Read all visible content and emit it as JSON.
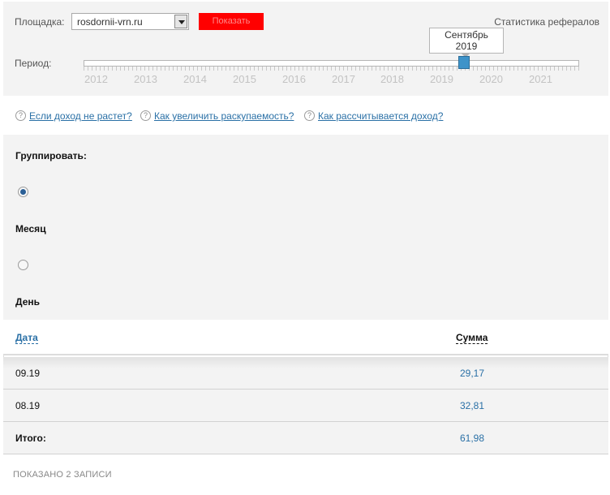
{
  "filters": {
    "site_label": "Площадка:",
    "site_value": "rosdornii-vrn.ru",
    "red_button_label": "Показать",
    "referral_stats_link": "Статистика рефералов"
  },
  "period": {
    "label": "Период:",
    "years": [
      "2012",
      "2013",
      "2014",
      "2015",
      "2016",
      "2017",
      "2018",
      "2019",
      "2020",
      "2021"
    ],
    "tooltip_month": "Сентябрь",
    "tooltip_year": "2019"
  },
  "help_links": [
    "Если доход не растет?",
    "Как увеличить раскупаемость?",
    "Как рассчитывается доход?"
  ],
  "help_icon_glyph": "?",
  "grouping": {
    "title": "Группировать:",
    "options": [
      {
        "label": "Месяц",
        "checked": true
      },
      {
        "label": "День",
        "checked": false
      }
    ]
  },
  "table": {
    "columns": {
      "date": "Дата",
      "sum": "Сумма"
    },
    "rows": [
      {
        "date": "09.19",
        "sum": "29,17"
      },
      {
        "date": "08.19",
        "sum": "32,81"
      }
    ],
    "total": {
      "label": "Итого:",
      "sum": "61,98"
    }
  },
  "footer": {
    "records_text": "ПОКАЗАНО 2 ЗАПИСИ"
  },
  "colors": {
    "accent_link": "#2a70a6",
    "red_button": "#ff0000",
    "slider_handle": "#3e93c9",
    "panel_bg": "#f3f3f3"
  }
}
